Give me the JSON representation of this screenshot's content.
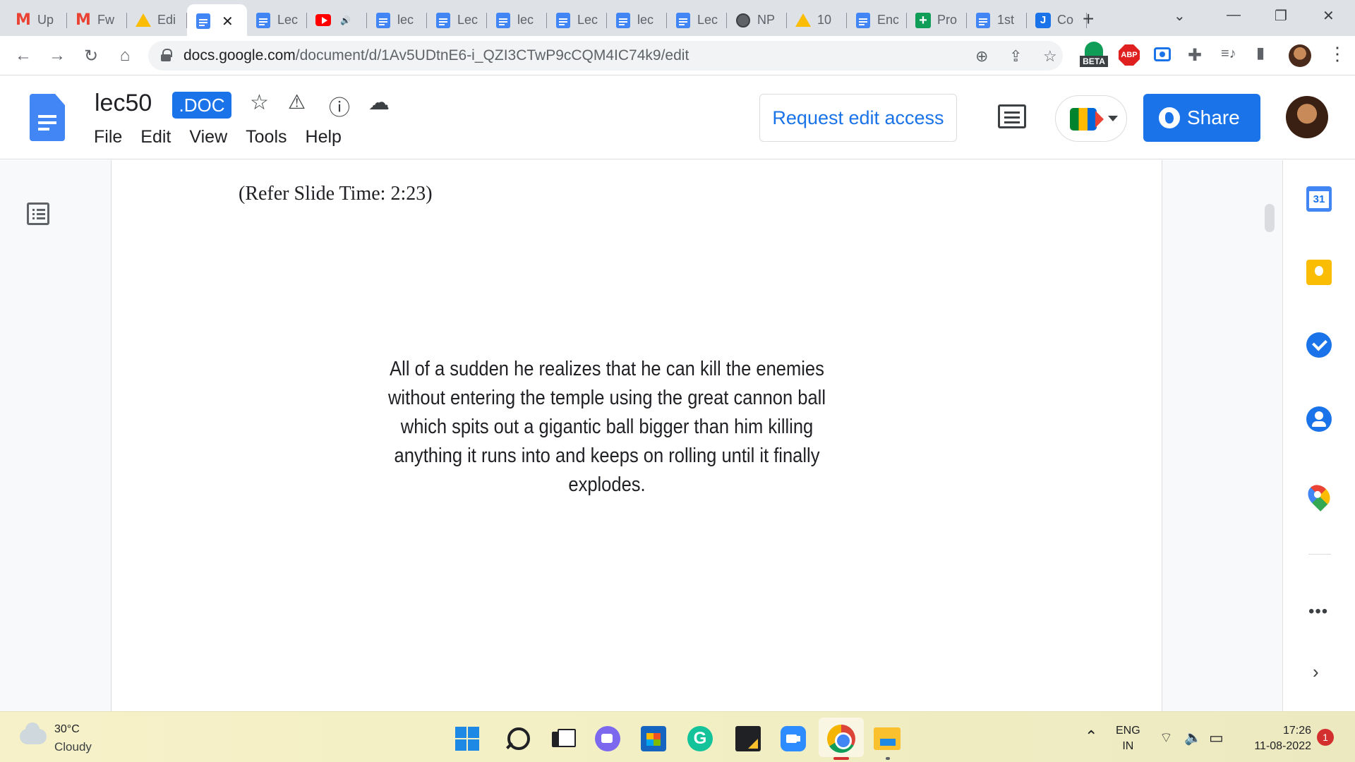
{
  "browser": {
    "tabs": [
      {
        "label": "Up",
        "icon": "gmail-icon"
      },
      {
        "label": "Fw",
        "icon": "gmail-icon"
      },
      {
        "label": "Edi",
        "icon": "drive-icon"
      },
      {
        "label": "",
        "icon": "docs-icon",
        "active": true,
        "close": "✕"
      },
      {
        "label": "Lec",
        "icon": "docs-icon"
      },
      {
        "label": "",
        "icon": "youtube-icon",
        "audio": "🔊"
      },
      {
        "label": "lec",
        "icon": "docs-icon"
      },
      {
        "label": "Lec",
        "icon": "docs-icon"
      },
      {
        "label": "lec",
        "icon": "docs-icon"
      },
      {
        "label": "Lec",
        "icon": "docs-icon"
      },
      {
        "label": "lec",
        "icon": "docs-icon"
      },
      {
        "label": "Lec",
        "icon": "docs-icon"
      },
      {
        "label": "NP",
        "icon": "globe-icon"
      },
      {
        "label": "10",
        "icon": "drive-icon"
      },
      {
        "label": "Enc",
        "icon": "docs-icon"
      },
      {
        "label": "Pro",
        "icon": "sheets-icon"
      },
      {
        "label": "1st",
        "icon": "docs-icon"
      },
      {
        "label": "Co",
        "icon": "j-icon"
      }
    ],
    "new_tab": "+",
    "window_controls": {
      "tab_search": "⌄",
      "minimize": "—",
      "restore": "❐",
      "close": "✕"
    },
    "nav": {
      "back": "←",
      "forward": "→",
      "reload": "↻",
      "home": "⌂"
    },
    "url_host": "docs.google.com",
    "url_path": "/document/d/1Av5UDtnE6-i_QZI3CTwP9cCQM4IC74k9/edit",
    "omnibox_icons": {
      "zoom": "⊕",
      "share": "⇪",
      "bookmark": "☆"
    },
    "extensions": {
      "beta_label": "BETA",
      "abp_label": "ABP",
      "media": "≡♪",
      "sidepanel": "▮",
      "menu": "⋮",
      "puzzle": "✚"
    }
  },
  "docs": {
    "title": "lec50",
    "badge": ".DOC",
    "title_icons": {
      "star": "☆",
      "drive": "⚠",
      "info": "ⓘ",
      "cloud": "☁"
    },
    "menus": [
      "File",
      "Edit",
      "View",
      "Tools",
      "Help"
    ],
    "request_access": "Request edit access",
    "share": "Share"
  },
  "document": {
    "slide_time": "(Refer Slide Time: 2:23)",
    "caption": "All of a sudden he realizes that he can kill the enemies without entering the temple using the great cannon ball which spits out a gigantic ball bigger than him killing anything it runs into and keeps on rolling until it finally explodes."
  },
  "side_panel": {
    "calendar_day": "31",
    "more": "•••",
    "expand": "›"
  },
  "taskbar": {
    "weather_temp": "30°C",
    "weather_cond": "Cloudy",
    "grammarly": "G",
    "tray_chevron": "⌃",
    "lang_top": "ENG",
    "lang_bottom": "IN",
    "wifi": "⌔",
    "volume": "🔈",
    "battery": "▭",
    "time": "17:26",
    "date": "11-08-2022",
    "notifications": "1"
  }
}
